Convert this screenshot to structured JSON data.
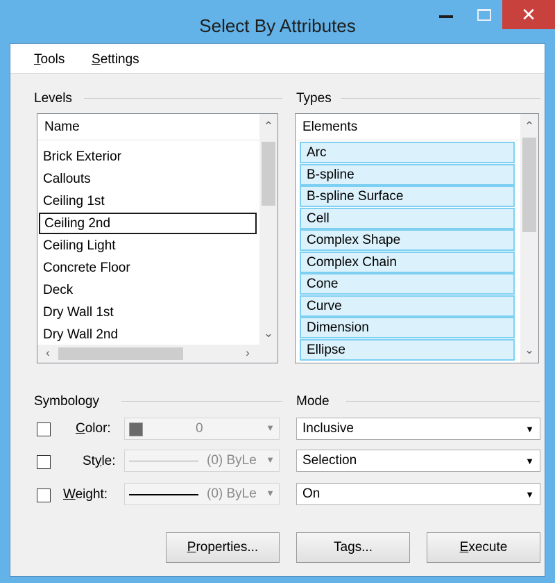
{
  "window": {
    "title": "Select By Attributes"
  },
  "menu": {
    "tools": {
      "mnemonic": "T",
      "rest": "ools"
    },
    "settings": {
      "mnemonic": "S",
      "rest": "ettings"
    }
  },
  "levels": {
    "label": "Levels",
    "column": "Name",
    "items": [
      "Brick Exterior",
      "Callouts",
      "Ceiling 1st",
      "Ceiling 2nd",
      "Ceiling Light",
      "Concrete Floor",
      "Deck",
      "Dry Wall 1st",
      "Dry Wall 2nd"
    ],
    "focused_item": "Ceiling 2nd"
  },
  "types": {
    "label": "Types",
    "column": "Elements",
    "items": [
      "Arc",
      "B-spline",
      "B-spline Surface",
      "Cell",
      "Complex Shape",
      "Complex Chain",
      "Cone",
      "Curve",
      "Dimension",
      "Ellipse"
    ]
  },
  "symbology": {
    "label": "Symbology",
    "color": {
      "mnemonic": "C",
      "rest": "olor:",
      "value": "0"
    },
    "style": {
      "pre": "St",
      "mnemonic": "y",
      "rest": "le:",
      "value": "(0) ByLe"
    },
    "weight": {
      "mnemonic": "W",
      "rest": "eight:",
      "value": "(0) ByLe"
    }
  },
  "mode": {
    "label": "Mode",
    "mode_value": "Inclusive",
    "selection_value": "Selection",
    "state_value": "On"
  },
  "buttons": {
    "properties": {
      "mnemonic": "P",
      "rest": "roperties..."
    },
    "tags": {
      "pre": "Ta",
      "mnemonic": "g",
      "rest": "s..."
    },
    "execute": {
      "mnemonic": "E",
      "rest": "xecute"
    }
  },
  "colors": {
    "titlebar": "#63b3e9",
    "close": "#c9413c",
    "selected_bg": "#dbf1fb",
    "selected_border": "#7dd0f2"
  }
}
